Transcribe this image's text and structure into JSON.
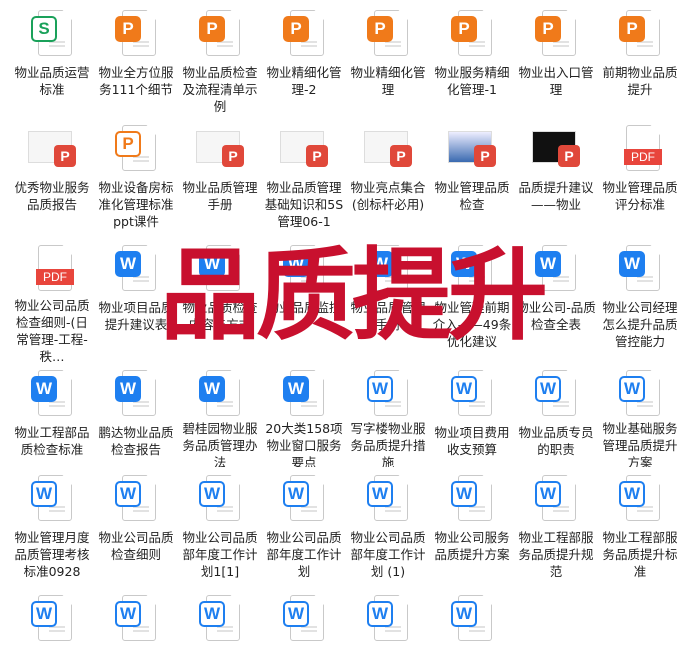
{
  "overlay_text": "品质提升",
  "colors": {
    "overlay": "#c8102e",
    "word": "#1e7ff0",
    "ppt": "#f07a1a",
    "pdf": "#e8453c",
    "xls": "#1aa15a"
  },
  "rows": [
    [
      {
        "type": "xls",
        "glyph": "S",
        "label": "物业品质运营标准"
      },
      {
        "type": "ppt",
        "glyph": "P",
        "label": "物业全方位服务111个细节"
      },
      {
        "type": "ppt",
        "glyph": "P",
        "label": "物业品质检查及流程清单示例"
      },
      {
        "type": "ppt",
        "glyph": "P",
        "label": "物业精细化管理-2"
      },
      {
        "type": "ppt",
        "glyph": "P",
        "label": "物业精细化管理"
      },
      {
        "type": "ppt",
        "glyph": "P",
        "label": "物业服务精细化管理-1"
      },
      {
        "type": "ppt",
        "glyph": "P",
        "label": "物业出入口管理"
      },
      {
        "type": "ppt",
        "glyph": "P",
        "label": "前期物业品质提升"
      }
    ],
    [
      {
        "type": "thumb",
        "glyph": "P",
        "label": "优秀物业服务品质报告"
      },
      {
        "type": "ppt2",
        "glyph": "P",
        "label": "物业设备房标准化管理标准ppt课件"
      },
      {
        "type": "thumb",
        "glyph": "P",
        "label": "物业品质管理手册"
      },
      {
        "type": "thumb",
        "glyph": "P",
        "label": "物业品质管理基础知识和5S管理06-1"
      },
      {
        "type": "thumb",
        "glyph": "P",
        "label": "物业亮点集合(创标杆必用)"
      },
      {
        "type": "thumb-blue",
        "glyph": "P",
        "label": "物业管理品质检查"
      },
      {
        "type": "thumb-dark",
        "glyph": "P",
        "label": "品质提升建议——物业"
      },
      {
        "type": "pdf",
        "glyph": "PDF",
        "label": "物业管理品质评分标准"
      }
    ],
    [
      {
        "type": "pdf",
        "glyph": "PDF",
        "label": "物业公司品质检查细则-(日常管理-工程-秩…"
      },
      {
        "type": "doc",
        "glyph": "W",
        "label": "物业项目品质提升建议表"
      },
      {
        "type": "doc",
        "glyph": "W",
        "label": "物业品质检查内容与方式"
      },
      {
        "type": "doc",
        "glyph": "W",
        "label": "物业品质监控"
      },
      {
        "type": "doc",
        "glyph": "W",
        "label": "物业品质管理手册"
      },
      {
        "type": "doc",
        "glyph": "W",
        "label": "物业管理前期介入——49条优化建议"
      },
      {
        "type": "doc",
        "glyph": "W",
        "label": "物业公司-品质检查全表"
      },
      {
        "type": "doc",
        "glyph": "W",
        "label": "物业公司经理怎么提升品质管控能力"
      }
    ],
    [
      {
        "type": "doc",
        "glyph": "W",
        "label": "物业工程部品质检查标准"
      },
      {
        "type": "doc",
        "glyph": "W",
        "label": "鹏达物业品质检查报告"
      },
      {
        "type": "doc",
        "glyph": "W",
        "label": "碧桂园物业服务品质管理办法"
      },
      {
        "type": "doc",
        "glyph": "W",
        "label": "20大类158项物业窗口服务要点"
      },
      {
        "type": "doc2",
        "glyph": "W",
        "label": "写字楼物业服务品质提升措施"
      },
      {
        "type": "doc2",
        "glyph": "W",
        "label": "物业项目费用收支预算"
      },
      {
        "type": "doc2",
        "glyph": "W",
        "label": "物业品质专员的职责"
      },
      {
        "type": "doc2",
        "glyph": "W",
        "label": "物业基础服务管理品质提升方案"
      }
    ],
    [
      {
        "type": "doc2",
        "glyph": "W",
        "label": "物业管理月度品质管理考核标准0928"
      },
      {
        "type": "doc2",
        "glyph": "W",
        "label": "物业公司品质检查细则"
      },
      {
        "type": "doc2",
        "glyph": "W",
        "label": "物业公司品质部年度工作计划1[1]"
      },
      {
        "type": "doc2",
        "glyph": "W",
        "label": "物业公司品质部年度工作计划"
      },
      {
        "type": "doc2",
        "glyph": "W",
        "label": "物业公司品质部年度工作计划 (1)"
      },
      {
        "type": "doc2",
        "glyph": "W",
        "label": "物业公司服务品质提升方案"
      },
      {
        "type": "doc2",
        "glyph": "W",
        "label": "物业工程部服务品质提升规范"
      },
      {
        "type": "doc2",
        "glyph": "W",
        "label": "物业工程部服务品质提升标准"
      }
    ],
    [
      {
        "type": "doc2",
        "glyph": "W",
        "label": ""
      },
      {
        "type": "doc2",
        "glyph": "W",
        "label": ""
      },
      {
        "type": "doc2",
        "glyph": "W",
        "label": ""
      },
      {
        "type": "doc2",
        "glyph": "W",
        "label": ""
      },
      {
        "type": "doc2",
        "glyph": "W",
        "label": ""
      },
      {
        "type": "doc2",
        "glyph": "W",
        "label": ""
      }
    ]
  ]
}
